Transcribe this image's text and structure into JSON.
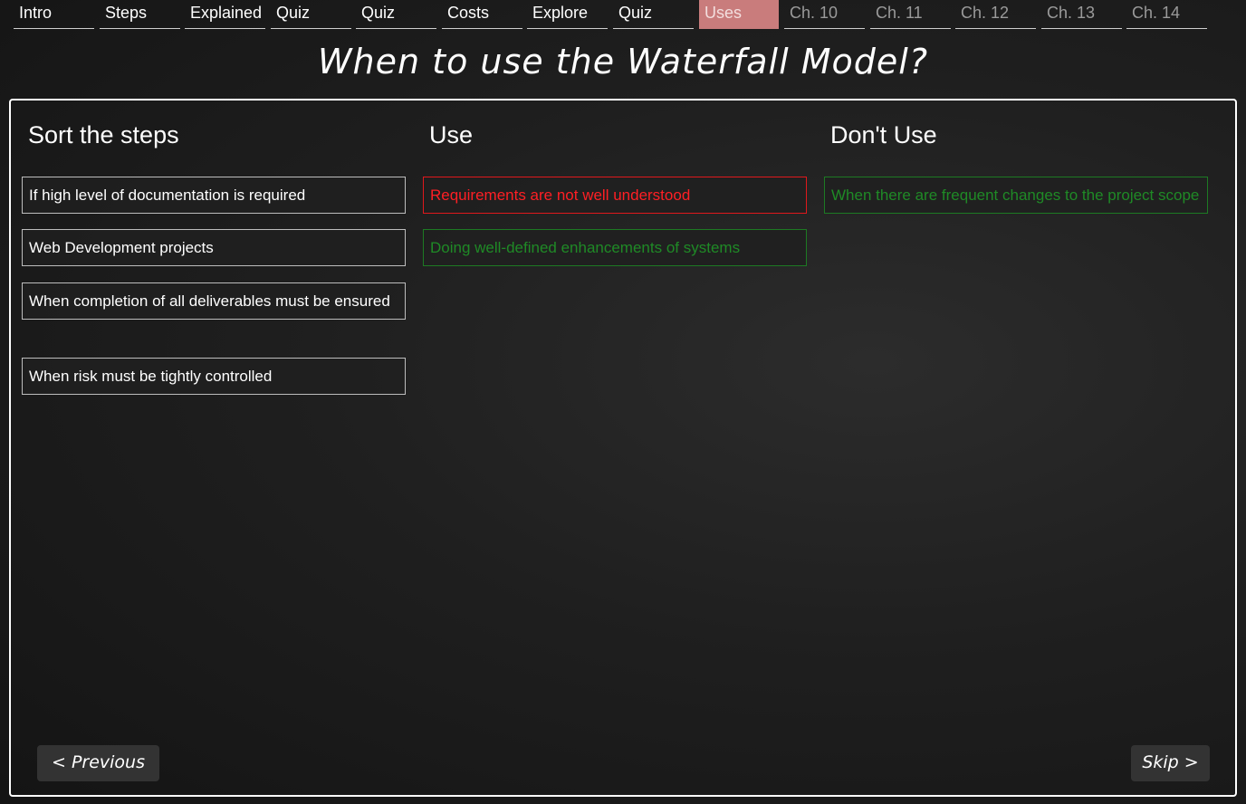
{
  "nav": {
    "tabs": [
      {
        "label": "Intro"
      },
      {
        "label": "Steps"
      },
      {
        "label": "Explained"
      },
      {
        "label": "Quiz"
      },
      {
        "label": "Quiz"
      },
      {
        "label": "Costs"
      },
      {
        "label": "Explore"
      },
      {
        "label": "Quiz"
      },
      {
        "label": "Uses"
      },
      {
        "label": "Ch. 10"
      },
      {
        "label": "Ch. 11"
      },
      {
        "label": "Ch. 12"
      },
      {
        "label": "Ch. 13"
      },
      {
        "label": "Ch. 14"
      }
    ],
    "active_tab": "Uses",
    "active_color": "#c97c7c"
  },
  "page": {
    "title": "When to use the Waterfall Model?"
  },
  "columns": {
    "sort": {
      "heading": "Sort the steps",
      "items": [
        "If high level of documentation is required",
        "Web Development projects",
        "When completion of all deliverables must be ensured",
        "When risk must be tightly controlled"
      ]
    },
    "use": {
      "heading": "Use",
      "items": [
        {
          "text": "Requirements are not well understood",
          "state": "incorrect"
        },
        {
          "text": "Doing well-defined enhancements of systems",
          "state": "correct"
        }
      ]
    },
    "dont_use": {
      "heading": "Don't Use",
      "items": [
        {
          "text": "When there are frequent changes to the project scope",
          "state": "correct"
        }
      ]
    }
  },
  "colors": {
    "incorrect": "#ff1f24",
    "correct": "#1f8a26"
  },
  "buttons": {
    "previous": "< Previous",
    "skip": "Skip >"
  }
}
